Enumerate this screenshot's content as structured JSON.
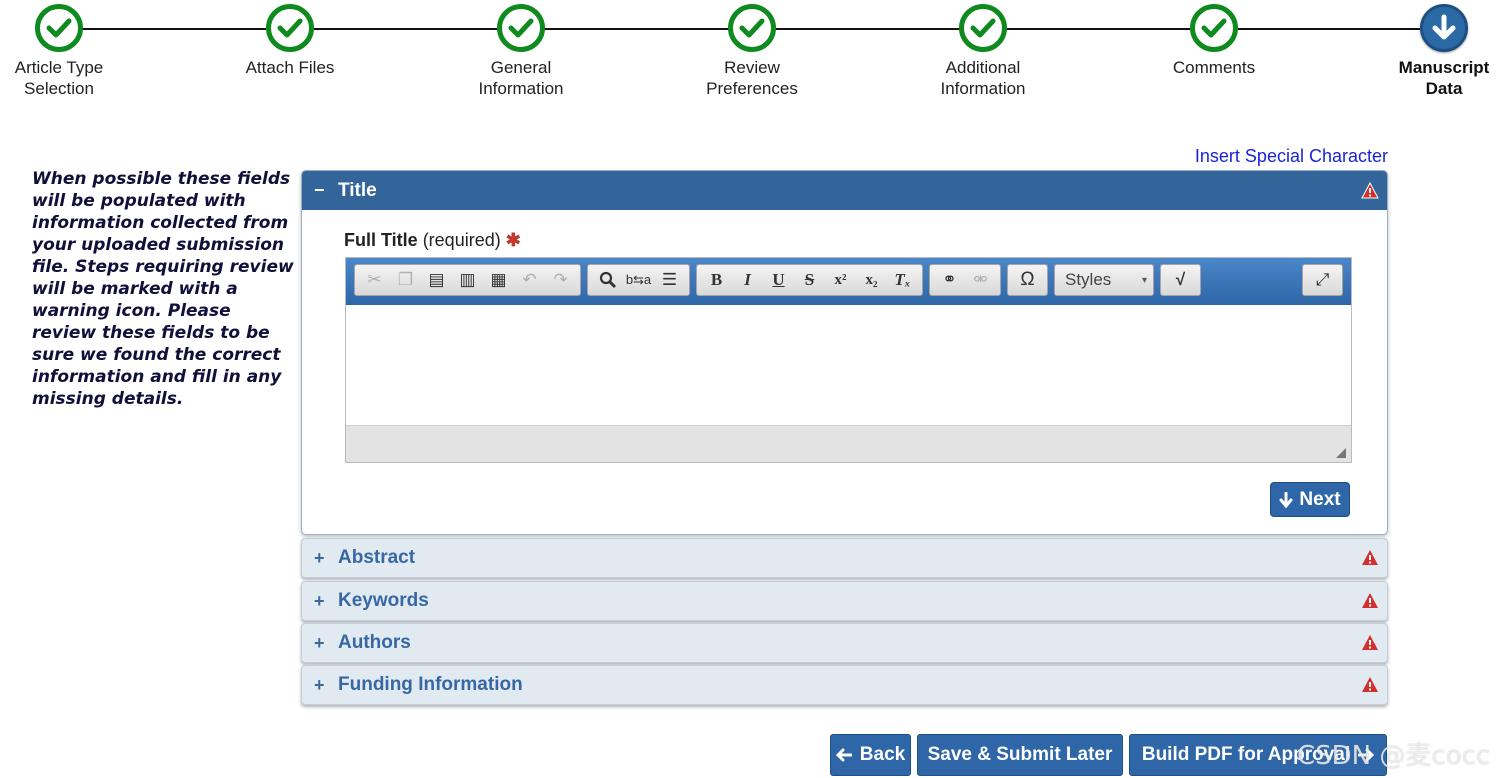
{
  "stepper": {
    "steps": [
      {
        "label_line1": "Article Type",
        "label_line2": "Selection",
        "status": "done"
      },
      {
        "label_line1": "Attach Files",
        "label_line2": "",
        "status": "done"
      },
      {
        "label_line1": "General",
        "label_line2": "Information",
        "status": "done"
      },
      {
        "label_line1": "Review",
        "label_line2": "Preferences",
        "status": "done"
      },
      {
        "label_line1": "Additional",
        "label_line2": "Information",
        "status": "done"
      },
      {
        "label_line1": "Comments",
        "label_line2": "",
        "status": "done"
      },
      {
        "label_line1": "Manuscript",
        "label_line2": "Data",
        "status": "current"
      }
    ]
  },
  "sidebar": {
    "note": "When possible these fields will be populated with information collected from your uploaded submission file. Steps requiring review will be marked with a warning icon. Please review these fields to be sure we found the correct information and fill in any missing details."
  },
  "insert_special_character": "Insert Special Character",
  "sections": {
    "title": {
      "toggle": "−",
      "name": "Title",
      "warning": true
    },
    "abstract": {
      "toggle": "+",
      "name": "Abstract",
      "warning": true
    },
    "keywords": {
      "toggle": "+",
      "name": "Keywords",
      "warning": true
    },
    "authors": {
      "toggle": "+",
      "name": "Authors",
      "warning": true
    },
    "funding": {
      "toggle": "+",
      "name": "Funding Information",
      "warning": true
    }
  },
  "field": {
    "label": "Full Title",
    "qualifier": "(required)",
    "required_mark": "✱",
    "value": ""
  },
  "editor": {
    "styles_label": "Styles",
    "buttons": [
      "cut",
      "copy",
      "paste",
      "paste-text",
      "paste-word",
      "undo",
      "redo",
      "find",
      "replace",
      "select-all",
      "bold",
      "italic",
      "underline",
      "strike",
      "superscript",
      "subscript",
      "remove-format",
      "link",
      "unlink",
      "special-char",
      "styles",
      "math",
      "maximize"
    ]
  },
  "next_button": "Next",
  "nav": {
    "back": "Back",
    "save": "Save & Submit Later",
    "pdf": "Build PDF for Approval"
  },
  "watermark": "CSDN @麦cocc",
  "colors": {
    "done_green": "#0f8a1f",
    "current_blue": "#2c6aa6",
    "header_blue": "#33659a",
    "warning_red": "#d32f2f",
    "link_blue": "#1a24d6"
  }
}
